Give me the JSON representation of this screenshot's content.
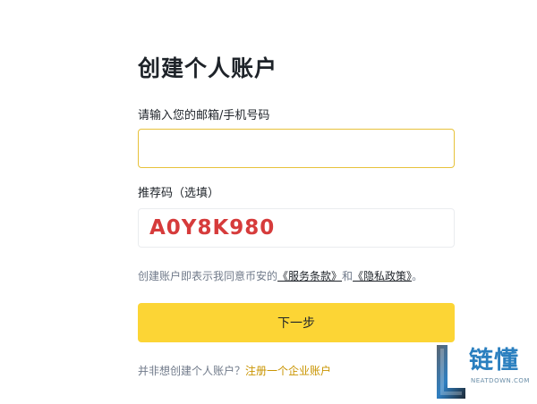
{
  "page": {
    "title": "创建个人账户"
  },
  "email": {
    "label": "请输入您的邮箱/手机号码",
    "value": ""
  },
  "referral": {
    "label": "推荐码（选填）",
    "code": "A0Y8K980"
  },
  "terms": {
    "prefix": "创建账户即表示我同意币安的",
    "service_link": "《服务条款》",
    "and": "和",
    "privacy_link": "《隐私政策》",
    "suffix": "。"
  },
  "actions": {
    "next_label": "下一步"
  },
  "footer": {
    "question": "并非想创建个人账户？",
    "enterprise_link": "注册一个企业账户"
  },
  "watermark": {
    "brand": "链懂",
    "domain": "NEATDOWN.COM"
  },
  "colors": {
    "accent": "#fcd535",
    "link_gold": "#c99400",
    "referral_red": "#d63b3b",
    "input_focus_border": "#e7c23a"
  }
}
